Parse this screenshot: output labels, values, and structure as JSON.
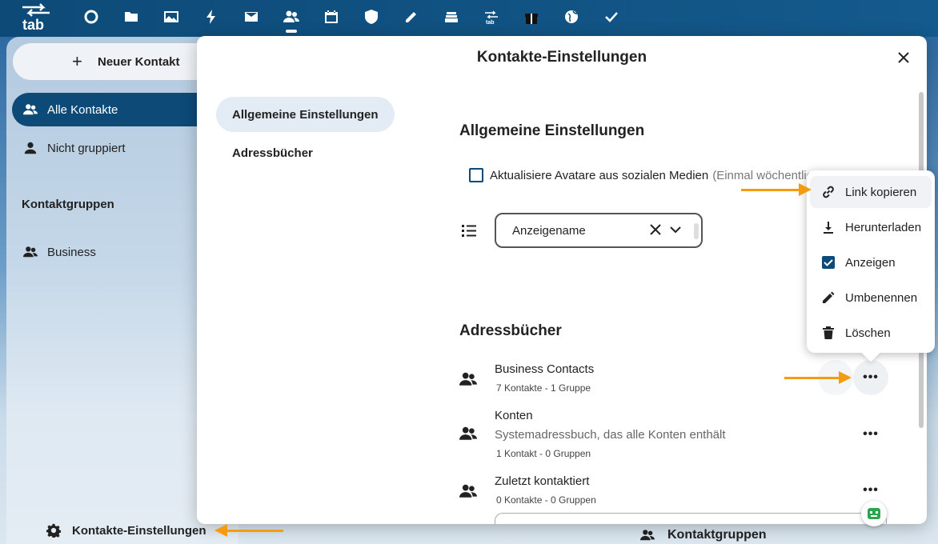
{
  "topbar": {
    "logo_text": "tab",
    "apps": [
      {
        "icon": "dashboard-circle-icon",
        "name": "app-dashboard"
      },
      {
        "icon": "folder-icon",
        "name": "app-files"
      },
      {
        "icon": "image-icon",
        "name": "app-photos"
      },
      {
        "icon": "lightning-icon",
        "name": "app-activity"
      },
      {
        "icon": "mail-icon",
        "name": "app-mail"
      },
      {
        "icon": "contacts-icon",
        "name": "app-contacts"
      },
      {
        "icon": "calendar-icon",
        "name": "app-calendar"
      },
      {
        "icon": "shield-icon",
        "name": "app-security"
      },
      {
        "icon": "pencil-icon",
        "name": "app-notes"
      },
      {
        "icon": "stack-icon",
        "name": "app-deck"
      },
      {
        "icon": "tab-logo-icon",
        "name": "app-tab"
      },
      {
        "icon": "gift-icon",
        "name": "app-gift"
      },
      {
        "icon": "globe-icon",
        "name": "app-web"
      },
      {
        "icon": "check-icon",
        "name": "app-tasks"
      }
    ]
  },
  "sidebar": {
    "new_contact": "Neuer Kontakt",
    "all_contacts": "Alle Kontakte",
    "not_grouped": "Nicht gruppiert",
    "groups_title": "Kontaktgruppen",
    "group_business": "Business",
    "settings": "Kontakte-Einstellungen"
  },
  "background": {
    "groups_header": "Kontaktgruppen"
  },
  "modal": {
    "title": "Kontakte-Einstellungen",
    "tabs": [
      "Allgemeine Einstellungen",
      "Adressbücher"
    ],
    "general_title": "Allgemeine Einstellungen",
    "avatar_checkbox_label": "Aktualisiere Avatare aus sozialen Medien",
    "avatar_checkbox_hint": "(Einmal wöchentlich",
    "avatar_checkbox_checked": false,
    "sort_select_value": "Anzeigename",
    "addressbooks_title": "Adressbücher",
    "addressbooks": [
      {
        "name": "Business Contacts",
        "description": "",
        "meta": "7 Kontakte  - 1 Gruppe"
      },
      {
        "name": "Konten",
        "description": "Systemadressbuch, das alle Konten enthält",
        "meta": "1 Kontakt  - 0 Gruppen"
      },
      {
        "name": "Zuletzt kontaktiert",
        "description": "",
        "meta": "0 Kontakte  - 0 Gruppen"
      }
    ],
    "more_label": "•••"
  },
  "menu": {
    "items": [
      {
        "label": "Link kopieren",
        "icon": "link-icon"
      },
      {
        "label": "Herunterladen",
        "icon": "download-icon"
      },
      {
        "label": "Anzeigen",
        "icon": "checkbox-checked-icon"
      },
      {
        "label": "Umbenennen",
        "icon": "pencil-icon"
      },
      {
        "label": "Löschen",
        "icon": "trash-icon"
      }
    ]
  },
  "colors": {
    "brand": "#0d4a78",
    "annotation_arrow": "#f39c12",
    "active_tab_bg": "#e3ecf5"
  }
}
